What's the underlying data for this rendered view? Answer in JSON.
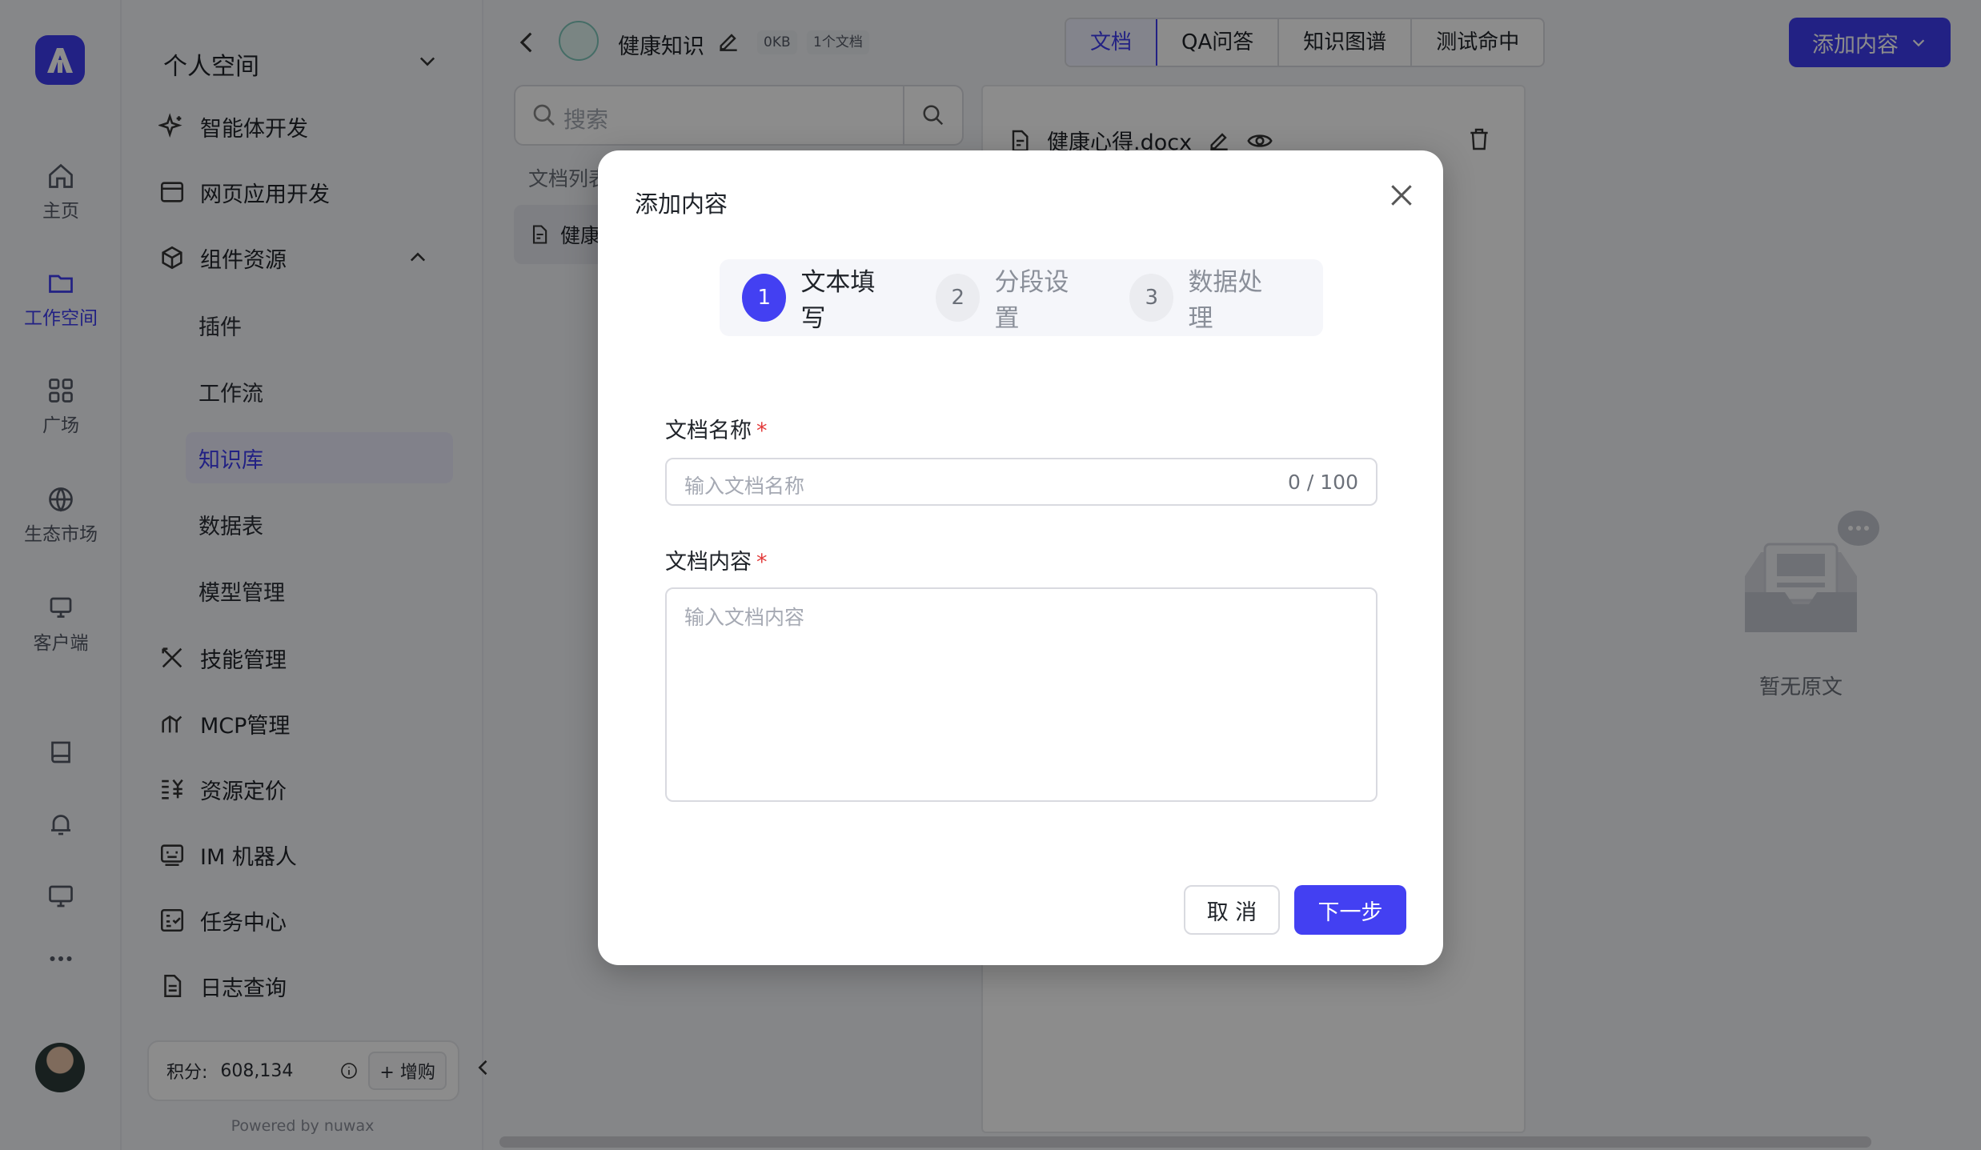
{
  "rail": {
    "items": [
      {
        "label": "主页",
        "icon": "home-icon"
      },
      {
        "label": "工作空间",
        "icon": "folder-icon"
      },
      {
        "label": "广场",
        "icon": "grid-icon"
      },
      {
        "label": "生态市场",
        "icon": "globe-icon"
      },
      {
        "label": "客户端",
        "icon": "monitor-icon"
      }
    ]
  },
  "sidebar": {
    "space_title": "个人空间",
    "items": [
      {
        "label": "智能体开发",
        "icon": "sparkle-icon"
      },
      {
        "label": "网页应用开发",
        "icon": "browser-icon"
      },
      {
        "label": "组件资源",
        "icon": "cube-icon"
      },
      {
        "label": "插件"
      },
      {
        "label": "工作流"
      },
      {
        "label": "知识库"
      },
      {
        "label": "数据表"
      },
      {
        "label": "模型管理"
      },
      {
        "label": "技能管理",
        "icon": "tools-icon"
      },
      {
        "label": "MCP管理",
        "icon": "mcp-icon"
      },
      {
        "label": "资源定价",
        "icon": "pricing-icon"
      },
      {
        "label": "IM 机器人",
        "icon": "robot-icon"
      },
      {
        "label": "任务中心",
        "icon": "task-icon"
      },
      {
        "label": "日志查询",
        "icon": "log-icon"
      }
    ],
    "credits_label": "积分:",
    "credits_value": "608,134",
    "buy_label": "+ 增购",
    "powered_by": "Powered by nuwax"
  },
  "header": {
    "kb_title": "健康知识",
    "size_tag": "0KB",
    "count_tag": "1个文档",
    "tabs": [
      "文档",
      "QA问答",
      "知识图谱",
      "测试命中"
    ],
    "add_button": "添加内容"
  },
  "list": {
    "search_placeholder": "搜索",
    "section_label": "文档列表",
    "doc_item": "健康"
  },
  "panel": {
    "file_name": "健康心得.docx",
    "empty_text": "暂无原文"
  },
  "modal": {
    "title": "添加内容",
    "steps": [
      {
        "num": "1",
        "label": "文本填写"
      },
      {
        "num": "2",
        "label": "分段设置"
      },
      {
        "num": "3",
        "label": "数据处理"
      }
    ],
    "name_label": "文档名称",
    "name_placeholder": "输入文档名称",
    "name_count": "0 / 100",
    "content_label": "文档内容",
    "content_placeholder": "输入文档内容",
    "required_mark": "*",
    "cancel": "取 消",
    "next": "下一步"
  },
  "colors": {
    "accent": "#3f3cf0",
    "required": "#e33b3b"
  }
}
